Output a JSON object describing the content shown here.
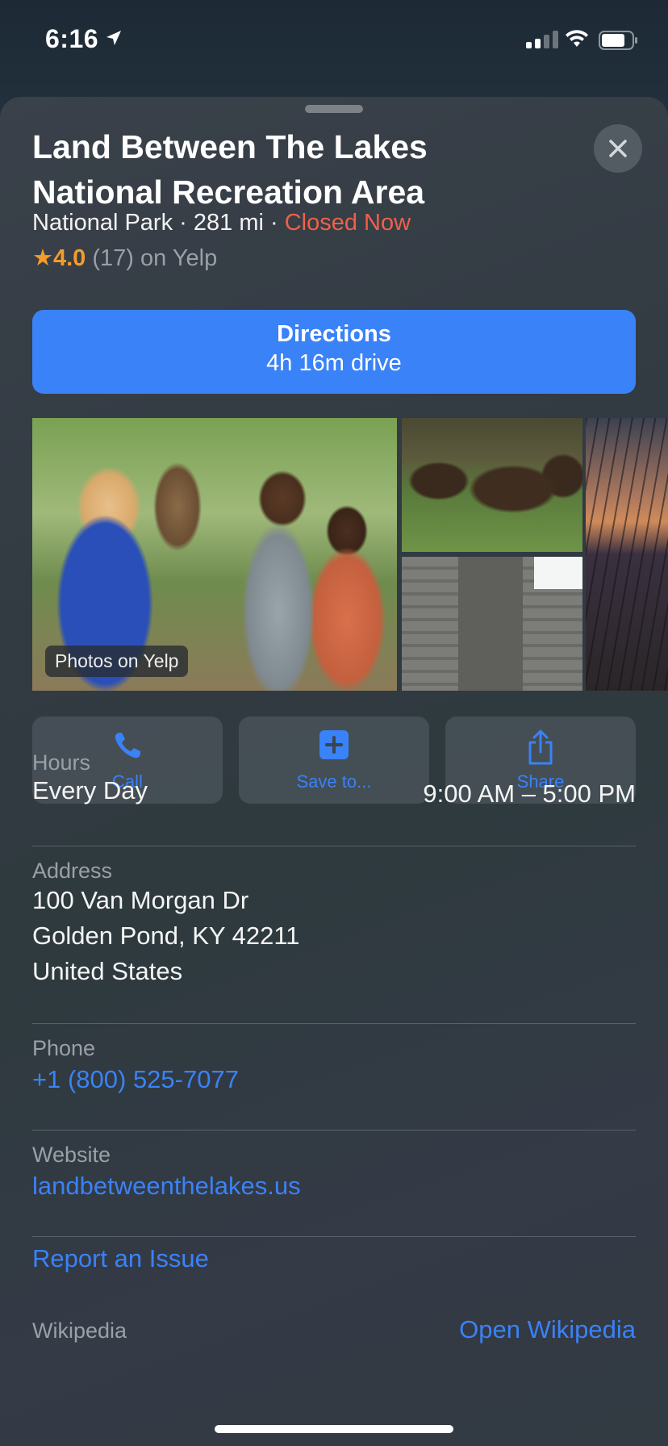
{
  "status_bar": {
    "time": "6:16",
    "icons": [
      "location-arrow-icon",
      "signal-icon",
      "wifi-icon",
      "battery-icon"
    ]
  },
  "place": {
    "name": "Land Between The Lakes National Recreation Area",
    "category": "National Park",
    "distance": "281 mi",
    "separator": " · ",
    "open_status": "Closed Now",
    "rating": "4.0",
    "review_count": "(17)",
    "rating_source": "on Yelp"
  },
  "directions": {
    "label": "Directions",
    "sublabel": "4h 16m drive"
  },
  "photos": {
    "label": "Photos on Yelp"
  },
  "actions": [
    {
      "label": "Call",
      "icon": "phone-icon"
    },
    {
      "label": "Save to...",
      "icon": "add-square-icon"
    },
    {
      "label": "Share",
      "icon": "share-icon"
    }
  ],
  "hours": {
    "label": "Hours",
    "day": "Every Day",
    "time": "9:00 AM – 5:00 PM"
  },
  "address": {
    "label": "Address",
    "line1": "100 Van Morgan Dr",
    "line2": "Golden Pond, KY  42211",
    "line3": "United States"
  },
  "phone": {
    "label": "Phone",
    "value": "+1 (800) 525-7077"
  },
  "website": {
    "label": "Website",
    "value": "landbetweenthelakes.us"
  },
  "report_issue": "Report an Issue",
  "wikipedia": {
    "label": "Wikipedia",
    "link": "Open Wikipedia"
  },
  "colors": {
    "accent": "#3a82f7",
    "closed": "#f0604a",
    "star": "#f39c2b"
  }
}
